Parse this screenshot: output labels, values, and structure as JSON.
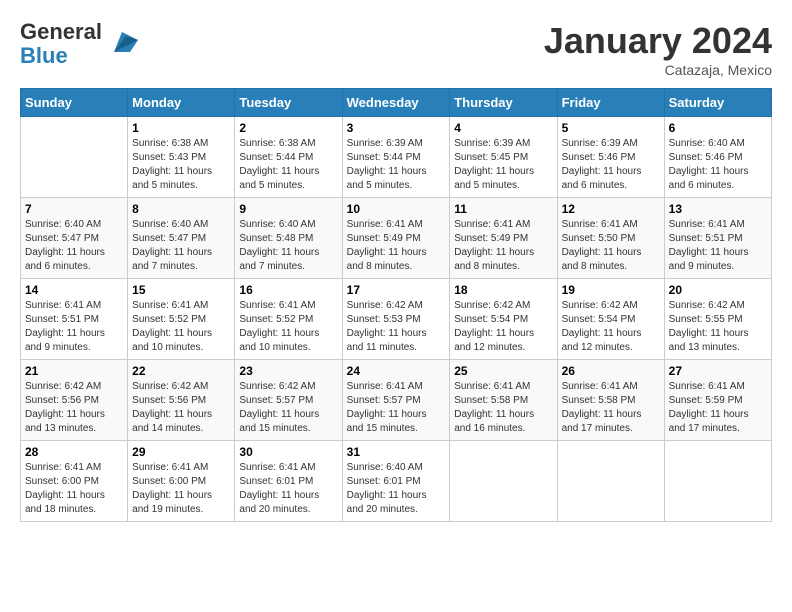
{
  "header": {
    "logo_line1": "General",
    "logo_line2": "Blue",
    "month_title": "January 2024",
    "location": "Catazaja, Mexico"
  },
  "weekdays": [
    "Sunday",
    "Monday",
    "Tuesday",
    "Wednesday",
    "Thursday",
    "Friday",
    "Saturday"
  ],
  "weeks": [
    [
      {
        "day": "",
        "sunrise": "",
        "sunset": "",
        "daylight": ""
      },
      {
        "day": "1",
        "sunrise": "Sunrise: 6:38 AM",
        "sunset": "Sunset: 5:43 PM",
        "daylight": "Daylight: 11 hours and 5 minutes."
      },
      {
        "day": "2",
        "sunrise": "Sunrise: 6:38 AM",
        "sunset": "Sunset: 5:44 PM",
        "daylight": "Daylight: 11 hours and 5 minutes."
      },
      {
        "day": "3",
        "sunrise": "Sunrise: 6:39 AM",
        "sunset": "Sunset: 5:44 PM",
        "daylight": "Daylight: 11 hours and 5 minutes."
      },
      {
        "day": "4",
        "sunrise": "Sunrise: 6:39 AM",
        "sunset": "Sunset: 5:45 PM",
        "daylight": "Daylight: 11 hours and 5 minutes."
      },
      {
        "day": "5",
        "sunrise": "Sunrise: 6:39 AM",
        "sunset": "Sunset: 5:46 PM",
        "daylight": "Daylight: 11 hours and 6 minutes."
      },
      {
        "day": "6",
        "sunrise": "Sunrise: 6:40 AM",
        "sunset": "Sunset: 5:46 PM",
        "daylight": "Daylight: 11 hours and 6 minutes."
      }
    ],
    [
      {
        "day": "7",
        "sunrise": "Sunrise: 6:40 AM",
        "sunset": "Sunset: 5:47 PM",
        "daylight": "Daylight: 11 hours and 6 minutes."
      },
      {
        "day": "8",
        "sunrise": "Sunrise: 6:40 AM",
        "sunset": "Sunset: 5:47 PM",
        "daylight": "Daylight: 11 hours and 7 minutes."
      },
      {
        "day": "9",
        "sunrise": "Sunrise: 6:40 AM",
        "sunset": "Sunset: 5:48 PM",
        "daylight": "Daylight: 11 hours and 7 minutes."
      },
      {
        "day": "10",
        "sunrise": "Sunrise: 6:41 AM",
        "sunset": "Sunset: 5:49 PM",
        "daylight": "Daylight: 11 hours and 8 minutes."
      },
      {
        "day": "11",
        "sunrise": "Sunrise: 6:41 AM",
        "sunset": "Sunset: 5:49 PM",
        "daylight": "Daylight: 11 hours and 8 minutes."
      },
      {
        "day": "12",
        "sunrise": "Sunrise: 6:41 AM",
        "sunset": "Sunset: 5:50 PM",
        "daylight": "Daylight: 11 hours and 8 minutes."
      },
      {
        "day": "13",
        "sunrise": "Sunrise: 6:41 AM",
        "sunset": "Sunset: 5:51 PM",
        "daylight": "Daylight: 11 hours and 9 minutes."
      }
    ],
    [
      {
        "day": "14",
        "sunrise": "Sunrise: 6:41 AM",
        "sunset": "Sunset: 5:51 PM",
        "daylight": "Daylight: 11 hours and 9 minutes."
      },
      {
        "day": "15",
        "sunrise": "Sunrise: 6:41 AM",
        "sunset": "Sunset: 5:52 PM",
        "daylight": "Daylight: 11 hours and 10 minutes."
      },
      {
        "day": "16",
        "sunrise": "Sunrise: 6:41 AM",
        "sunset": "Sunset: 5:52 PM",
        "daylight": "Daylight: 11 hours and 10 minutes."
      },
      {
        "day": "17",
        "sunrise": "Sunrise: 6:42 AM",
        "sunset": "Sunset: 5:53 PM",
        "daylight": "Daylight: 11 hours and 11 minutes."
      },
      {
        "day": "18",
        "sunrise": "Sunrise: 6:42 AM",
        "sunset": "Sunset: 5:54 PM",
        "daylight": "Daylight: 11 hours and 12 minutes."
      },
      {
        "day": "19",
        "sunrise": "Sunrise: 6:42 AM",
        "sunset": "Sunset: 5:54 PM",
        "daylight": "Daylight: 11 hours and 12 minutes."
      },
      {
        "day": "20",
        "sunrise": "Sunrise: 6:42 AM",
        "sunset": "Sunset: 5:55 PM",
        "daylight": "Daylight: 11 hours and 13 minutes."
      }
    ],
    [
      {
        "day": "21",
        "sunrise": "Sunrise: 6:42 AM",
        "sunset": "Sunset: 5:56 PM",
        "daylight": "Daylight: 11 hours and 13 minutes."
      },
      {
        "day": "22",
        "sunrise": "Sunrise: 6:42 AM",
        "sunset": "Sunset: 5:56 PM",
        "daylight": "Daylight: 11 hours and 14 minutes."
      },
      {
        "day": "23",
        "sunrise": "Sunrise: 6:42 AM",
        "sunset": "Sunset: 5:57 PM",
        "daylight": "Daylight: 11 hours and 15 minutes."
      },
      {
        "day": "24",
        "sunrise": "Sunrise: 6:41 AM",
        "sunset": "Sunset: 5:57 PM",
        "daylight": "Daylight: 11 hours and 15 minutes."
      },
      {
        "day": "25",
        "sunrise": "Sunrise: 6:41 AM",
        "sunset": "Sunset: 5:58 PM",
        "daylight": "Daylight: 11 hours and 16 minutes."
      },
      {
        "day": "26",
        "sunrise": "Sunrise: 6:41 AM",
        "sunset": "Sunset: 5:58 PM",
        "daylight": "Daylight: 11 hours and 17 minutes."
      },
      {
        "day": "27",
        "sunrise": "Sunrise: 6:41 AM",
        "sunset": "Sunset: 5:59 PM",
        "daylight": "Daylight: 11 hours and 17 minutes."
      }
    ],
    [
      {
        "day": "28",
        "sunrise": "Sunrise: 6:41 AM",
        "sunset": "Sunset: 6:00 PM",
        "daylight": "Daylight: 11 hours and 18 minutes."
      },
      {
        "day": "29",
        "sunrise": "Sunrise: 6:41 AM",
        "sunset": "Sunset: 6:00 PM",
        "daylight": "Daylight: 11 hours and 19 minutes."
      },
      {
        "day": "30",
        "sunrise": "Sunrise: 6:41 AM",
        "sunset": "Sunset: 6:01 PM",
        "daylight": "Daylight: 11 hours and 20 minutes."
      },
      {
        "day": "31",
        "sunrise": "Sunrise: 6:40 AM",
        "sunset": "Sunset: 6:01 PM",
        "daylight": "Daylight: 11 hours and 20 minutes."
      },
      {
        "day": "",
        "sunrise": "",
        "sunset": "",
        "daylight": ""
      },
      {
        "day": "",
        "sunrise": "",
        "sunset": "",
        "daylight": ""
      },
      {
        "day": "",
        "sunrise": "",
        "sunset": "",
        "daylight": ""
      }
    ]
  ]
}
